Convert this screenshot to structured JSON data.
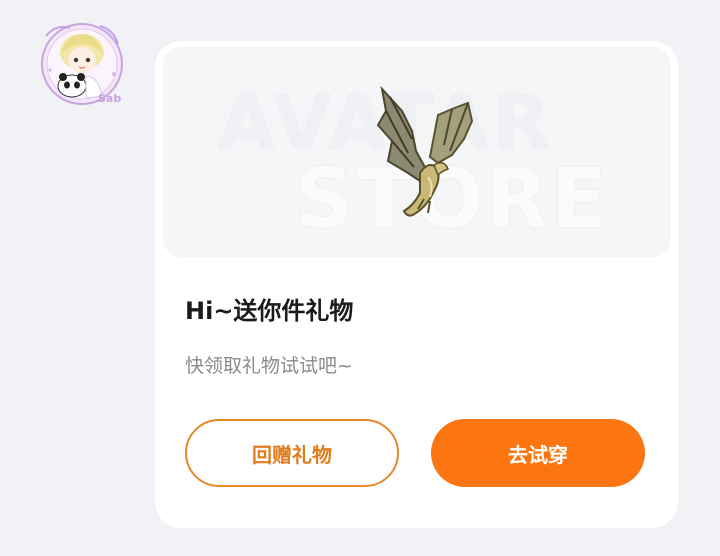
{
  "avatar": {
    "badge": "Sab"
  },
  "preview": {
    "watermark_line1": "AVATAR",
    "watermark_line2": "STORE"
  },
  "card": {
    "title": "Hi~送你件礼物",
    "subtitle": "快领取礼物试试吧~"
  },
  "actions": {
    "return_gift_label": "回赠礼物",
    "try_on_label": "去试穿"
  },
  "colors": {
    "accent": "#fb7510",
    "outline": "#e5892a",
    "background": "#f1f2f6"
  }
}
